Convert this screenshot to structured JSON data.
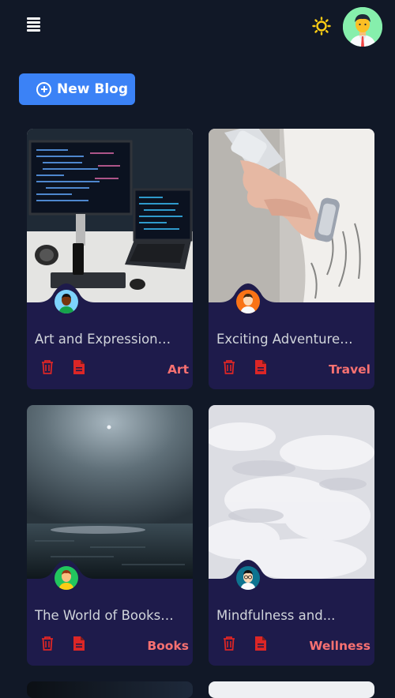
{
  "header": {
    "menu_icon": "hamburger-menu-icon",
    "theme_icon": "sun-icon",
    "avatar_icon": "user-avatar"
  },
  "actions": {
    "new_blog_label": "New Blog"
  },
  "blogs": [
    {
      "title": "Art and Expression:...",
      "tag": "Art",
      "image": "laptop-monitor-code-photo",
      "author_avatar": "avatar-dark-skin"
    },
    {
      "title": "Exciting Adventures i...",
      "tag": "Travel",
      "image": "hands-holding-phone-photo",
      "author_avatar": "avatar-orange"
    },
    {
      "title": "The World of Books: ...",
      "tag": "Books",
      "image": "dark-sea-moon-photo",
      "author_avatar": "avatar-yellow"
    },
    {
      "title": "Mindfulness and...",
      "tag": "Wellness",
      "image": "clouds-sky-photo",
      "author_avatar": "avatar-teal-glasses"
    }
  ],
  "colors": {
    "background": "#111827",
    "card": "#1e1b4b",
    "accent": "#3b82f6",
    "tag": "#f87171",
    "icon": "#dc2626"
  }
}
